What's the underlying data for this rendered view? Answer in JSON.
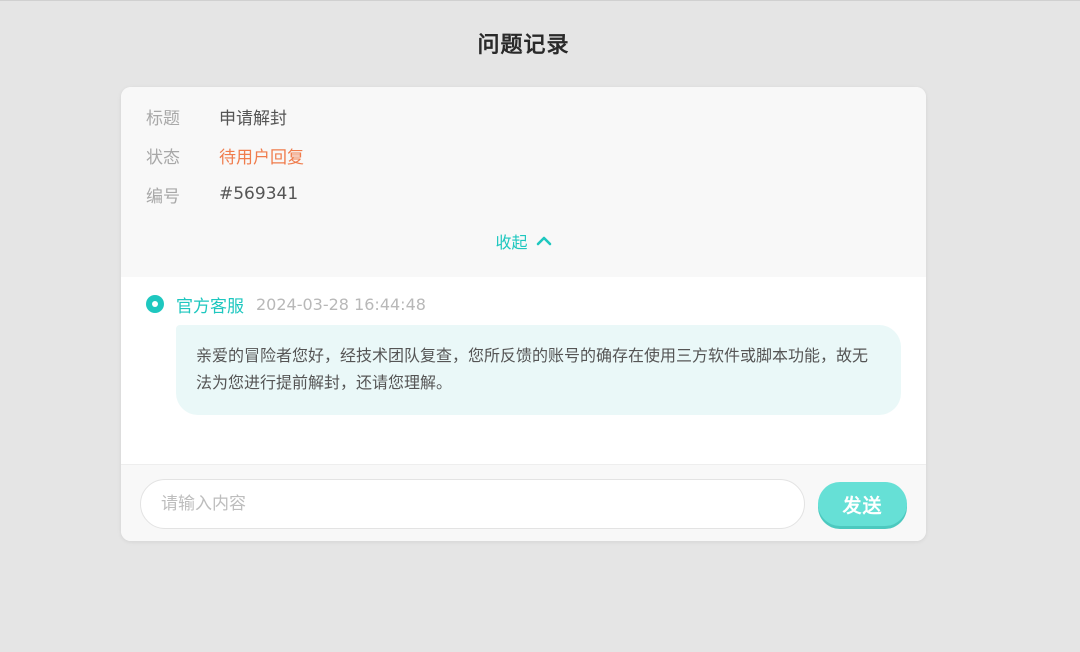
{
  "header": {
    "title": "问题记录"
  },
  "ticket": {
    "fields": [
      {
        "label": "标题",
        "value": "申请解封"
      },
      {
        "label": "状态",
        "value": "待用户回复"
      },
      {
        "label": "编号",
        "value": "#569341"
      }
    ],
    "collapse_label": "收起",
    "status_color": "#f07c4c"
  },
  "messages": [
    {
      "sender": "官方客服",
      "time": "2024-03-28 16:44:48",
      "text": "亲爱的冒险者您好，经技术团队复查，您所反馈的账号的确存在使用三方软件或脚本功能，故无法为您进行提前解封，还请您理解。"
    }
  ],
  "composer": {
    "placeholder": "请输入内容",
    "value": "",
    "send_label": "发送"
  },
  "colors": {
    "accent": "#1ec7bf",
    "send_button": "#66e0d6",
    "bubble": "#eaf8f8",
    "background": "#e5e5e5"
  },
  "icons": {
    "collapse": "chevron-up-icon",
    "sender_marker": "radio-dot-icon"
  }
}
